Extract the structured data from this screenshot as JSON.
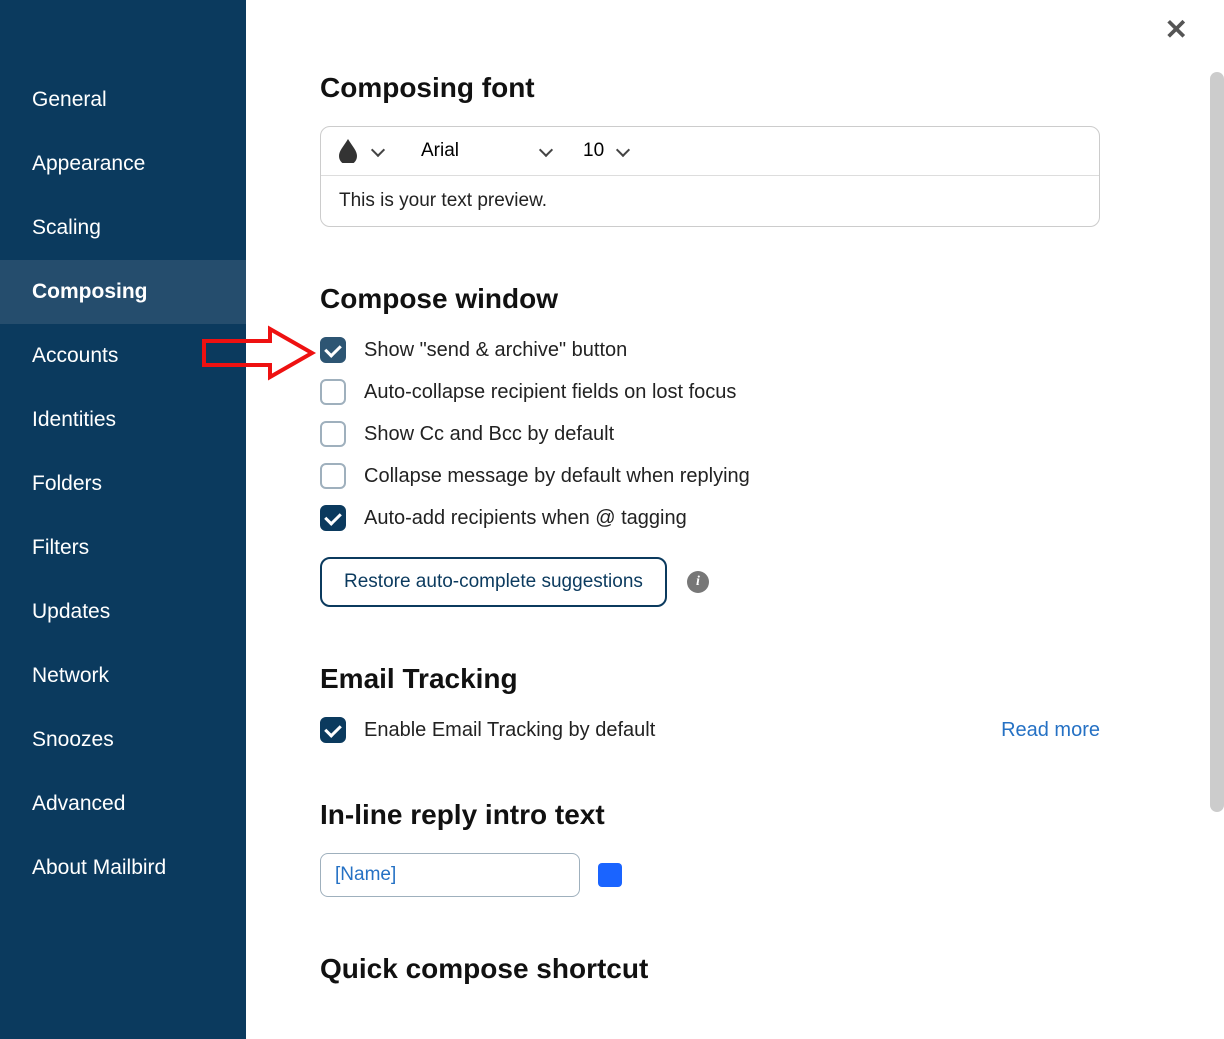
{
  "sidebar": {
    "items": [
      {
        "label": "General"
      },
      {
        "label": "Appearance"
      },
      {
        "label": "Scaling"
      },
      {
        "label": "Composing",
        "active": true
      },
      {
        "label": "Accounts"
      },
      {
        "label": "Identities"
      },
      {
        "label": "Folders"
      },
      {
        "label": "Filters"
      },
      {
        "label": "Updates"
      },
      {
        "label": "Network"
      },
      {
        "label": "Snoozes"
      },
      {
        "label": "Advanced"
      },
      {
        "label": "About Mailbird"
      }
    ]
  },
  "sections": {
    "font": {
      "title": "Composing font",
      "font_name": "Arial",
      "font_size": "10",
      "preview": "This is your text preview."
    },
    "compose": {
      "title": "Compose window",
      "options": [
        {
          "label": "Show \"send & archive\" button",
          "checked": true,
          "highlight": true
        },
        {
          "label": "Auto-collapse recipient fields on lost focus",
          "checked": false
        },
        {
          "label": "Show Cc and Bcc by default",
          "checked": false
        },
        {
          "label": "Collapse message by default when replying",
          "checked": false
        },
        {
          "label": "Auto-add recipients when @ tagging",
          "checked": true
        }
      ],
      "restore_label": "Restore auto-complete suggestions"
    },
    "tracking": {
      "title": "Email Tracking",
      "option_label": "Enable Email Tracking by default",
      "read_more": "Read more"
    },
    "inline": {
      "title": "In-line reply intro text",
      "value": "[Name]",
      "swatch_color": "#1a64ff"
    },
    "quick": {
      "title": "Quick compose shortcut"
    }
  }
}
